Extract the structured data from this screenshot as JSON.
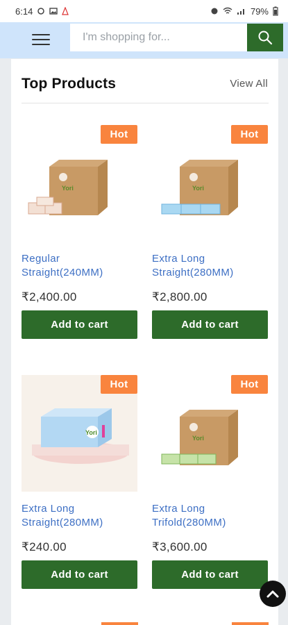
{
  "status_bar": {
    "time": "6:14",
    "battery": "79%"
  },
  "header": {
    "menu_icon": "hamburger-menu-icon",
    "search": {
      "placeholder": "I'm shopping for...",
      "value": "",
      "icon": "search-icon"
    }
  },
  "section": {
    "title": "Top Products",
    "view_all_label": "View All"
  },
  "products": [
    {
      "badge": "Hot",
      "name_line1": "Regular",
      "name_line2": "Straight(240MM)",
      "price": "₹2,400.00",
      "cart_label": "Add to cart"
    },
    {
      "badge": "Hot",
      "name_line1": "Extra Long",
      "name_line2": "Straight(280MM)",
      "price": "₹2,800.00",
      "cart_label": "Add to cart"
    },
    {
      "badge": "Hot",
      "name_line1": "Extra Long",
      "name_line2": "Straight(280MM)",
      "price": "₹240.00",
      "cart_label": "Add to cart"
    },
    {
      "badge": "Hot",
      "name_line1": "Extra Long",
      "name_line2": "Trifold(280MM)",
      "price": "₹3,600.00",
      "cart_label": "Add to cart"
    }
  ],
  "colors": {
    "brand_green": "#2d6b2a",
    "hot_badge": "#f9843e",
    "link_blue": "#3d6fc4",
    "header_bg": "#cfe4fb"
  },
  "scroll_top_icon": "chevron-up-icon"
}
